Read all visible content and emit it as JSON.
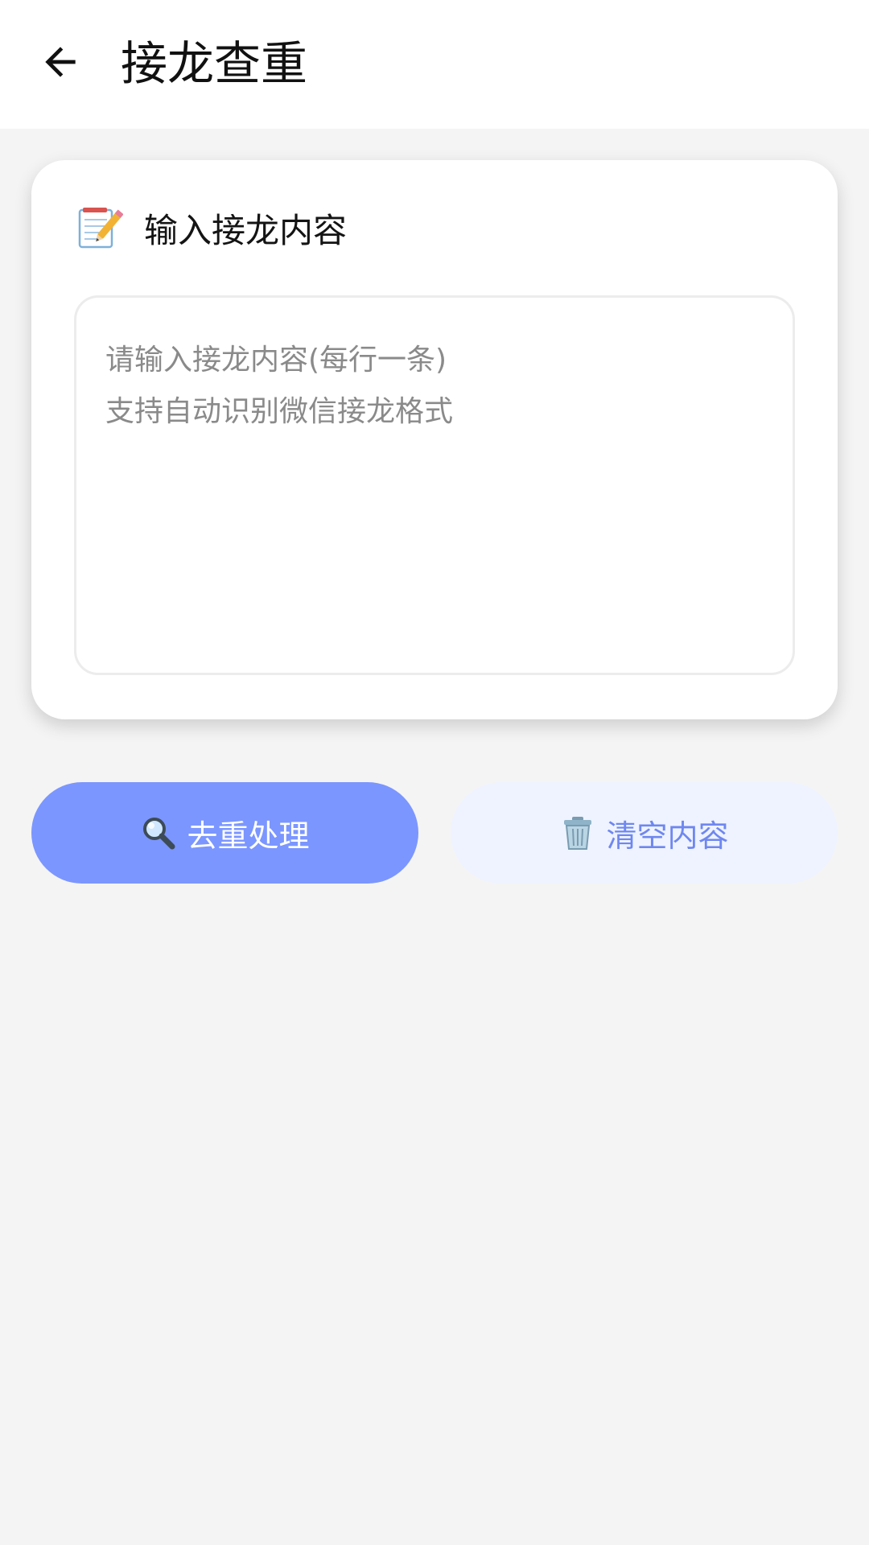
{
  "header": {
    "back_icon": "arrow-left-icon",
    "title": "接龙查重"
  },
  "input_card": {
    "icon": "memo-icon",
    "title": "输入接龙内容",
    "placeholder": "请输入接龙内容(每行一条)\n支持自动识别微信接龙格式",
    "value": ""
  },
  "actions": {
    "dedupe": {
      "icon": "magnifier-icon",
      "label": "去重处理"
    },
    "clear": {
      "icon": "trash-icon",
      "label": "清空内容"
    }
  },
  "colors": {
    "primary": "#7b96ff",
    "secondary_bg": "#eef3ff",
    "secondary_text": "#6f87ef",
    "page_bg": "#f4f4f4"
  }
}
